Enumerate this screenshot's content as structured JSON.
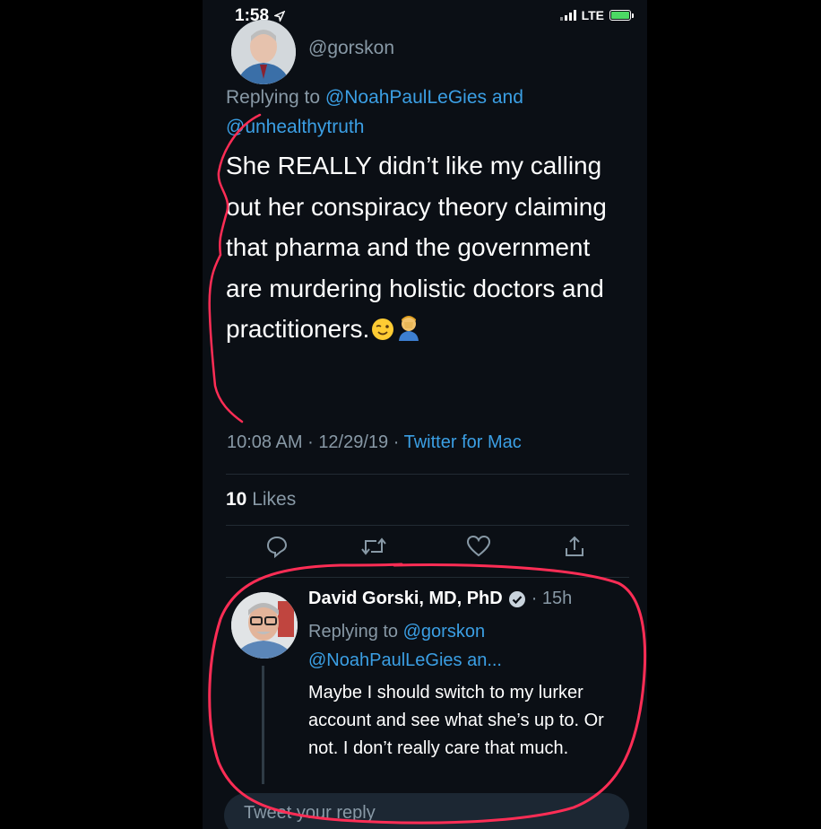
{
  "status_bar": {
    "time": "1:58",
    "network": "LTE"
  },
  "main_tweet": {
    "handle": "@gorskon",
    "replying_prefix": "Replying to ",
    "replying_user_1": "@NoahPaulLeGies",
    "replying_and": " and",
    "replying_user_2": "@unhealthytruth",
    "text": "She REALLY didn’t like my calling out her conspiracy theory claiming that pharma and the government are murdering holistic doctors and practitioners.",
    "emojis": [
      "winking-face",
      "person-facepalming"
    ],
    "time": "10:08 AM",
    "date": "12/29/19",
    "separator": "·",
    "source": "Twitter for Mac",
    "likes_count": "10",
    "likes_label": " Likes"
  },
  "actions": [
    {
      "name": "reply-icon"
    },
    {
      "name": "retweet-icon"
    },
    {
      "name": "like-icon"
    },
    {
      "name": "share-icon"
    }
  ],
  "reply_tweet": {
    "author": "David Gorski, MD, PhD",
    "verified": true,
    "time": "· 15h",
    "replying_prefix": "Replying to ",
    "replying_user_1": "@gorskon",
    "replying_user_2": "@NoahPaulLeGies an...",
    "text": "Maybe I should switch to my lurker account and see what she’s up to. Or not. I don’t really care that much."
  },
  "compose": {
    "placeholder": "Tweet your reply"
  },
  "colors": {
    "background": "#0b0f15",
    "link": "#3b9fe4",
    "secondary_text": "#8899a6",
    "annotation": "#ff2d55"
  }
}
